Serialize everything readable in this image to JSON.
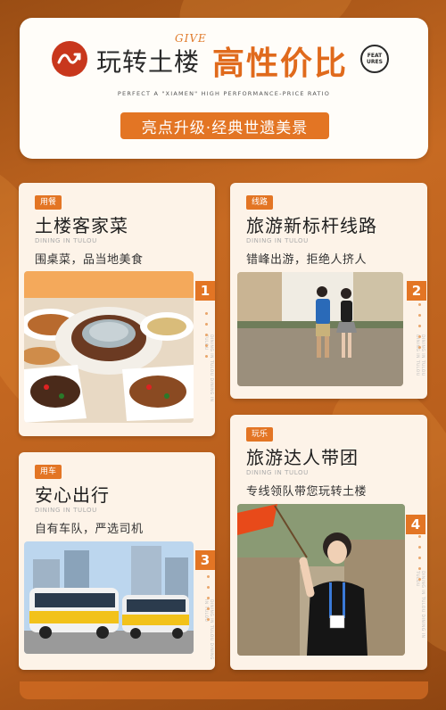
{
  "header": {
    "give": "GIVE",
    "title_left": "玩转土楼",
    "title_right": "高性价比",
    "features_badge": "FEAT URES",
    "tagline_en": "PERFECT A \"XIAMEN\" HIGH PERFORMANCE-PRICE RATIO",
    "pill": "亮点升级·经典世遗美景"
  },
  "cards": [
    {
      "tag": "用餐",
      "title": "土楼客家菜",
      "en": "DINING IN TULOU",
      "desc": "围桌菜，品当地美食",
      "num": "1",
      "side": "DINING IN TULOU DINING IN TULOU"
    },
    {
      "tag": "线路",
      "title": "旅游新标杆线路",
      "en": "DINING IN TULOU",
      "desc": "错峰出游，拒绝人挤人",
      "num": "2",
      "side": "DINING IN TULOU DINING IN TULOU"
    },
    {
      "tag": "用车",
      "title": "安心出行",
      "en": "DINING IN TULOU",
      "desc": "自有车队，严选司机",
      "num": "3",
      "side": "DINING IN TULOU DINING IN TULOU"
    },
    {
      "tag": "玩乐",
      "title": "旅游达人带团",
      "en": "DINING IN TULOU",
      "desc": "专线领队带您玩转土楼",
      "num": "4",
      "side": "DINING IN TULOU DINING IN TULOU"
    }
  ],
  "colors": {
    "accent": "#e37524",
    "logo_red": "#c8371d",
    "card_bg": "#fdf3e8"
  }
}
